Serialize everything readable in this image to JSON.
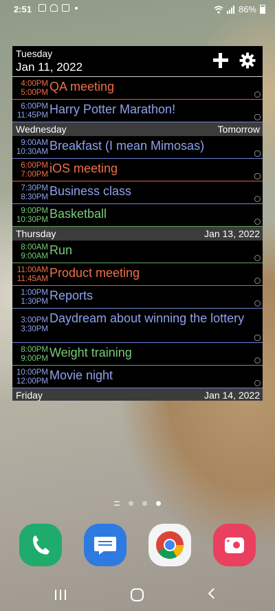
{
  "status_bar": {
    "time": "2:51",
    "battery": "86%",
    "left_icons": [
      "image-icon",
      "weather-icon",
      "calendar-icon",
      "dot-icon"
    ],
    "right_icons": [
      "wifi-icon",
      "signal-icon",
      "battery-icon"
    ]
  },
  "widget": {
    "header": {
      "weekday": "Tuesday",
      "date": "Jan 11, 2022",
      "add_icon": "plus-icon",
      "settings_icon": "gear-icon"
    },
    "colors": {
      "orange": "#f07048",
      "blue": "#8ea2ee",
      "green": "#78cc78",
      "day_header_bg": "#3c3c3c"
    },
    "days": [
      {
        "label": "",
        "right": "",
        "events": [
          {
            "start": "4:00PM",
            "end": "5:00PM",
            "title": "QA meeting",
            "color": "orange",
            "icon": "repeat-icon"
          },
          {
            "start": "6:00PM",
            "end": "11:45PM",
            "title": "Harry Potter Marathon!",
            "color": "blue",
            "icon": "alarm-icon"
          }
        ]
      },
      {
        "label": "Wednesday",
        "right": "Tomorrow",
        "events": [
          {
            "start": "9:00AM",
            "end": "10:30AM",
            "title": "Breakfast (I mean Mimosas)",
            "color": "blue",
            "icon": "alarm-icon"
          },
          {
            "start": "6:00PM",
            "end": "7:00PM",
            "title": "iOS meeting",
            "color": "orange",
            "icon": "alarm-icon"
          },
          {
            "start": "7:30PM",
            "end": "8:30PM",
            "title": "Business class",
            "color": "blue",
            "icon": "repeat-icon"
          },
          {
            "start": "9:00PM",
            "end": "10:30PM",
            "title": "Basketball",
            "color": "green",
            "icon": "repeat-icon"
          }
        ]
      },
      {
        "label": "Thursday",
        "right": "Jan 13, 2022",
        "events": [
          {
            "start": "8:00AM",
            "end": "9:00AM",
            "title": "Run",
            "color": "green",
            "icon": "repeat-icon"
          },
          {
            "start": "11:00AM",
            "end": "11:45AM",
            "title": "Product meeting",
            "color": "orange",
            "icon": "repeat-icon"
          },
          {
            "start": "1:00PM",
            "end": "1:30PM",
            "title": "Reports",
            "color": "blue",
            "icon": "repeat-icon"
          },
          {
            "start": "3:00PM",
            "end": "3:30PM",
            "title": "Daydream about winning the lottery",
            "color": "blue",
            "icon": "alarm-icon"
          },
          {
            "start": "8:00PM",
            "end": "9:00PM",
            "title": "Weight training",
            "color": "green",
            "icon": "repeat-icon"
          },
          {
            "start": "10:00PM",
            "end": "12:00PM",
            "title": "Movie night",
            "color": "blue",
            "icon": "repeat-icon"
          }
        ]
      },
      {
        "label": "Friday",
        "right": "Jan 14, 2022",
        "events": []
      }
    ]
  },
  "home": {
    "page_indicator": {
      "pages": 3,
      "active_index": 2
    },
    "dock": [
      {
        "name": "Phone",
        "icon": "phone-icon",
        "color": "#1fab6b"
      },
      {
        "name": "Messages",
        "icon": "messages-icon",
        "color": "#2d7be0"
      },
      {
        "name": "Chrome",
        "icon": "chrome-icon",
        "color": "#f4f4f4"
      },
      {
        "name": "Camera",
        "icon": "camera-icon",
        "color": "#ea3f5e"
      }
    ],
    "nav": [
      "recents-icon",
      "home-icon",
      "back-icon"
    ]
  }
}
